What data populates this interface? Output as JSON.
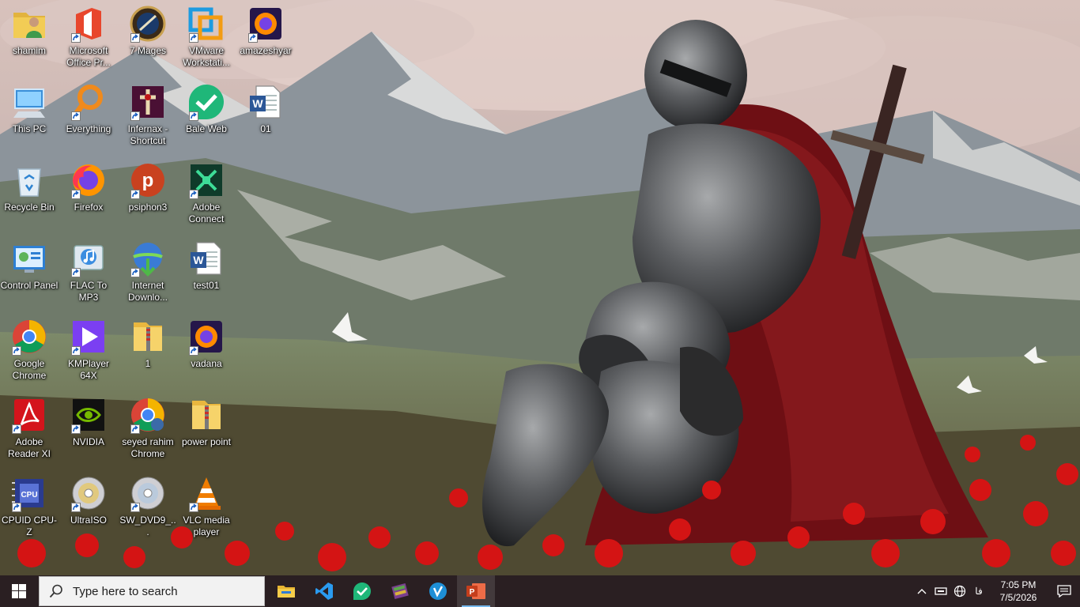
{
  "desktop": {
    "icons": [
      {
        "label": "shamim",
        "icon": "user-folder-icon",
        "shortcut": false
      },
      {
        "label": "This PC",
        "icon": "computer-icon",
        "shortcut": false
      },
      {
        "label": "Recycle Bin",
        "icon": "recycle-bin-icon",
        "shortcut": false
      },
      {
        "label": "Control Panel",
        "icon": "control-panel-icon",
        "shortcut": false
      },
      {
        "label": "Google Chrome",
        "icon": "chrome-icon",
        "shortcut": true
      },
      {
        "label": "Adobe Reader XI",
        "icon": "adobe-reader-icon",
        "shortcut": true
      },
      {
        "label": "CPUID CPU-Z",
        "icon": "cpuz-icon",
        "shortcut": true
      },
      {
        "label": "Microsoft Office Pr...",
        "icon": "office-icon",
        "shortcut": true
      },
      {
        "label": "Everything",
        "icon": "everything-search-icon",
        "shortcut": true
      },
      {
        "label": "Firefox",
        "icon": "firefox-icon",
        "shortcut": true
      },
      {
        "label": "FLAC To MP3",
        "icon": "flac-to-mp3-icon",
        "shortcut": true
      },
      {
        "label": "KMPlayer 64X",
        "icon": "kmplayer-icon",
        "shortcut": true
      },
      {
        "label": "NVIDIA",
        "icon": "nvidia-icon",
        "shortcut": true
      },
      {
        "label": "UltraISO",
        "icon": "disc-icon",
        "shortcut": true
      },
      {
        "label": "7 Mages",
        "icon": "game-7-mages-icon",
        "shortcut": true
      },
      {
        "label": "Infernax - Shortcut",
        "icon": "infernax-icon",
        "shortcut": true
      },
      {
        "label": "psiphon3",
        "icon": "psiphon-icon",
        "shortcut": true
      },
      {
        "label": "Internet Downlo...",
        "icon": "idm-icon",
        "shortcut": true
      },
      {
        "label": "1",
        "icon": "zip-folder-icon",
        "shortcut": false
      },
      {
        "label": "seyed rahim Chrome",
        "icon": "chrome-profile-icon",
        "shortcut": true
      },
      {
        "label": "SW_DVD9_...",
        "icon": "disc-image-icon",
        "shortcut": true
      },
      {
        "label": "VMware Workstati...",
        "icon": "vmware-icon",
        "shortcut": true
      },
      {
        "label": "Bale Web",
        "icon": "bale-icon",
        "shortcut": true
      },
      {
        "label": "Adobe Connect",
        "icon": "adobe-connect-icon",
        "shortcut": true
      },
      {
        "label": "test01",
        "icon": "word-document-icon",
        "shortcut": false
      },
      {
        "label": "vadana",
        "icon": "firefox-private-icon",
        "shortcut": true
      },
      {
        "label": "power point",
        "icon": "zip-folder-icon",
        "shortcut": false
      },
      {
        "label": "VLC media player",
        "icon": "vlc-icon",
        "shortcut": true
      },
      {
        "label": "amazeshyar",
        "icon": "firefox-private-icon",
        "shortcut": true
      },
      {
        "label": "01",
        "icon": "word-document-icon",
        "shortcut": false
      }
    ]
  },
  "taskbar": {
    "start_icon": "windows-logo-icon",
    "search_placeholder": "Type here to search",
    "pinned": [
      {
        "name": "file-explorer",
        "icon": "folder-icon",
        "active": false
      },
      {
        "name": "vscode",
        "icon": "vscode-icon",
        "active": false
      },
      {
        "name": "bale",
        "icon": "bale-icon",
        "active": false
      },
      {
        "name": "winrar",
        "icon": "winrar-icon",
        "active": false
      },
      {
        "name": "app-v",
        "icon": "v-app-icon",
        "active": false
      },
      {
        "name": "powerpoint",
        "icon": "powerpoint-icon",
        "active": true
      }
    ],
    "tray": {
      "language": "فا",
      "time": "7:05 PM",
      "date": "7/5/2026"
    }
  },
  "colors": {
    "taskbar_bg": "#2a1f22",
    "active_indicator": "#76b9ed"
  }
}
